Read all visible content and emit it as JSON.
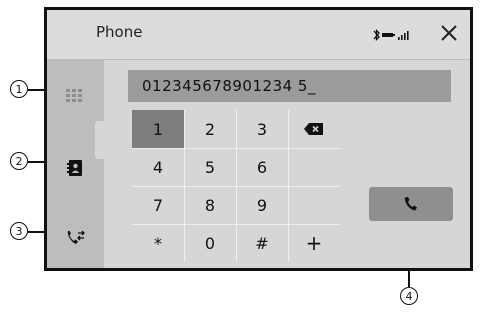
{
  "header": {
    "title": "Phone"
  },
  "sidebar": {
    "icons": [
      "dialpad-icon",
      "contacts-icon",
      "call-history-icon"
    ]
  },
  "dialer": {
    "number": "012345678901234 5_"
  },
  "keypad": {
    "keys": [
      "1",
      "2",
      "3",
      "",
      "4",
      "5",
      "6",
      "",
      "7",
      "8",
      "9",
      "",
      "*",
      "0",
      "#",
      "+"
    ]
  },
  "callouts": [
    "1",
    "2",
    "3",
    "4"
  ],
  "colors": {
    "frame": "#111111",
    "background": "#d6d6d6",
    "sidebar": "#bdbdbd",
    "active_key": "#7e7e7e",
    "display": "#9b9b9b"
  }
}
